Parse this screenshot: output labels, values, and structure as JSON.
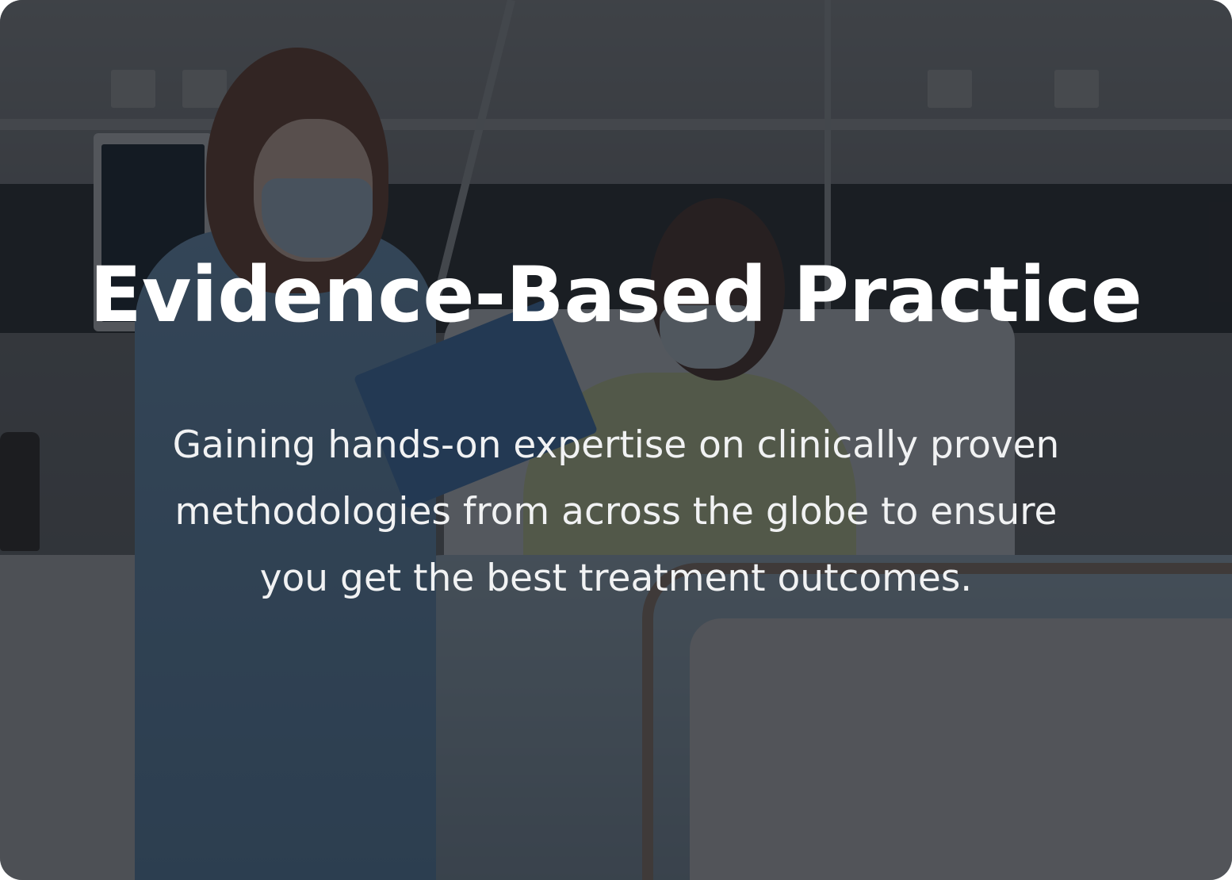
{
  "card": {
    "title": "Evidence-Based Practice",
    "description_lines": [
      "Gaining hands-on expertise on clinically proven",
      "methodologies from across the globe to ensure",
      "you get the best treatment outcomes."
    ]
  },
  "colors": {
    "overlay": "#16191E",
    "text": "#FFFFFF",
    "accent_scrubs": "#5A88B0"
  }
}
